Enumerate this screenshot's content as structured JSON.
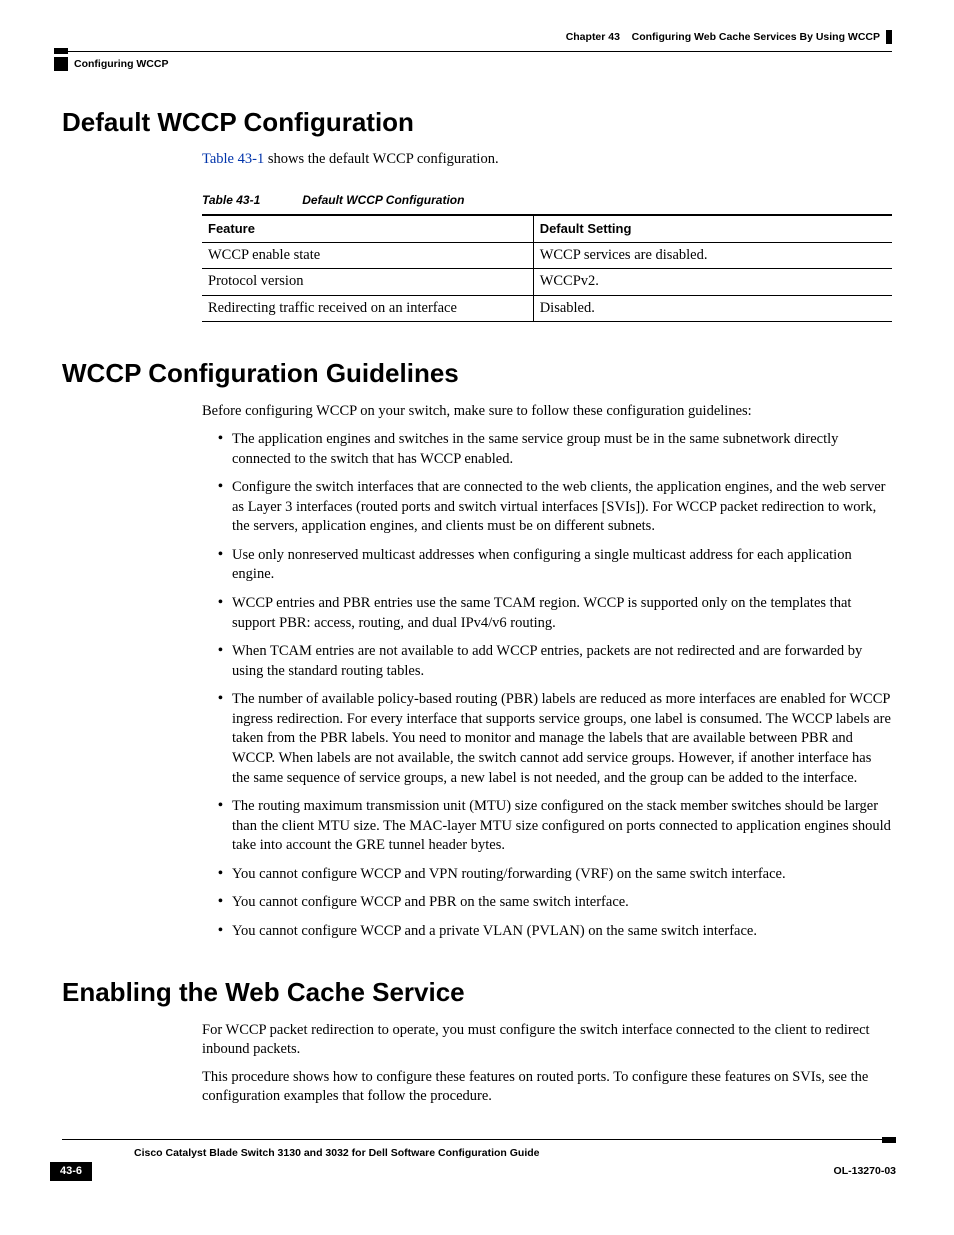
{
  "header": {
    "chapter_ref": "Chapter 43",
    "chapter_title": "Configuring Web Cache Services By Using WCCP",
    "section_left": "Configuring WCCP"
  },
  "sect1": {
    "title": "Default WCCP Configuration",
    "intro_link": "Table 43-1",
    "intro_rest": " shows the default WCCP configuration.",
    "table": {
      "caption_num": "Table 43-1",
      "caption_title": "Default WCCP Configuration",
      "headers": {
        "h1": "Feature",
        "h2": "Default Setting"
      },
      "rows": [
        {
          "f": "WCCP enable state",
          "d": "WCCP services are disabled."
        },
        {
          "f": "Protocol version",
          "d": "WCCPv2."
        },
        {
          "f": "Redirecting traffic received on an interface",
          "d": "Disabled."
        }
      ]
    }
  },
  "sect2": {
    "title": "WCCP Configuration Guidelines",
    "intro": "Before configuring WCCP on your switch, make sure to follow these configuration guidelines:",
    "bullets": [
      "The application engines and switches in the same service group must be in the same subnetwork directly connected to the switch that has WCCP enabled.",
      "Configure the switch interfaces that are connected to the web clients, the application engines, and the web server as Layer 3 interfaces (routed ports and switch virtual interfaces [SVIs]). For WCCP packet redirection to work, the servers, application engines, and clients must be on different subnets.",
      "Use only nonreserved multicast addresses when configuring a single multicast address for each application engine.",
      "WCCP entries and PBR entries use the same TCAM region. WCCP is supported only on the templates that support PBR: access, routing, and dual IPv4/v6 routing.",
      "When TCAM entries are not available to add WCCP entries, packets are not redirected and are forwarded by using the standard routing tables.",
      "The number of available policy-based routing (PBR) labels are reduced as more interfaces are enabled for WCCP ingress redirection. For every interface that supports service groups, one label is consumed. The WCCP labels are taken from the PBR labels. You need to monitor and manage the labels that are available between PBR and WCCP. When labels are not available, the switch cannot add service groups. However, if another interface has the same sequence of service groups, a new label is not needed, and the group can be added to the interface.",
      "The routing maximum transmission unit (MTU) size configured on the stack member switches should be larger than the client MTU size. The MAC-layer MTU size configured on ports connected to application engines should take into account the GRE tunnel header bytes.",
      "You cannot configure WCCP and VPN routing/forwarding (VRF) on the same switch interface.",
      "You cannot configure WCCP and PBR on the same switch interface.",
      "You cannot configure WCCP and a private VLAN (PVLAN) on the same switch interface."
    ]
  },
  "sect3": {
    "title": "Enabling the Web Cache Service",
    "p1": "For WCCP packet redirection to operate, you must configure the switch interface connected to the client to redirect inbound packets.",
    "p2": "This procedure shows how to configure these features on routed ports. To configure these features on SVIs, see the configuration examples that follow the procedure."
  },
  "footer": {
    "book": "Cisco Catalyst Blade Switch 3130 and 3032 for Dell Software Configuration Guide",
    "page": "43-6",
    "docid": "OL-13270-03"
  }
}
